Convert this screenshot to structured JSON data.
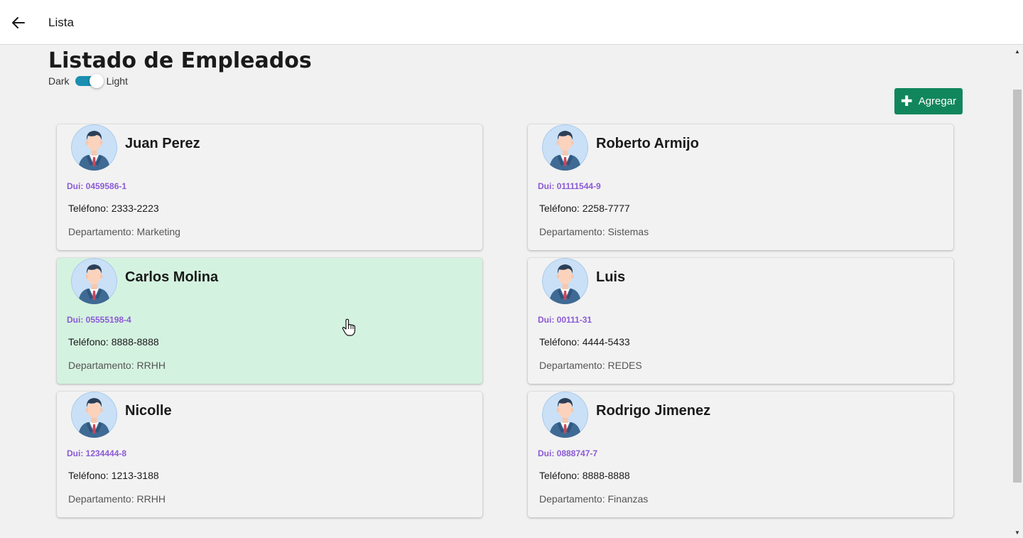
{
  "appbar": {
    "title": "Lista",
    "back_icon": "arrow-left-icon"
  },
  "page": {
    "title": "Listado de Empleados",
    "theme": {
      "dark_label": "Dark",
      "light_label": "Light",
      "state": "Light"
    },
    "add_button": {
      "label": "Agregar",
      "icon": "plus-icon",
      "color": "#11865d"
    }
  },
  "colors": {
    "dui": "#8b5ad6",
    "hover_card": "#d4f2e0",
    "toggle": "#1b8fb1"
  },
  "employees": [
    {
      "name": "Juan Perez",
      "dui": "Dui: 0459586-1",
      "phone": "Teléfono: 2333-2223",
      "department": "Departamento: Marketing"
    },
    {
      "name": "Roberto Armijo",
      "dui": "Dui: 01111544-9",
      "phone": "Teléfono: 2258-7777",
      "department": "Departamento: Sistemas"
    },
    {
      "name": "Carlos Molina",
      "dui": "Dui: 05555198-4",
      "phone": "Teléfono: 8888-8888",
      "department": "Departamento: RRHH"
    },
    {
      "name": "Luis",
      "dui": "Dui: 00111-31",
      "phone": "Teléfono: 4444-5433",
      "department": "Departamento: REDES"
    },
    {
      "name": "Nicolle",
      "dui": "Dui: 1234444-8",
      "phone": "Teléfono: 1213-3188",
      "department": "Departamento: RRHH"
    },
    {
      "name": "Rodrigo Jimenez",
      "dui": "Dui: 0888747-7",
      "phone": "Teléfono: 8888-8888",
      "department": "Departamento: Finanzas"
    }
  ]
}
